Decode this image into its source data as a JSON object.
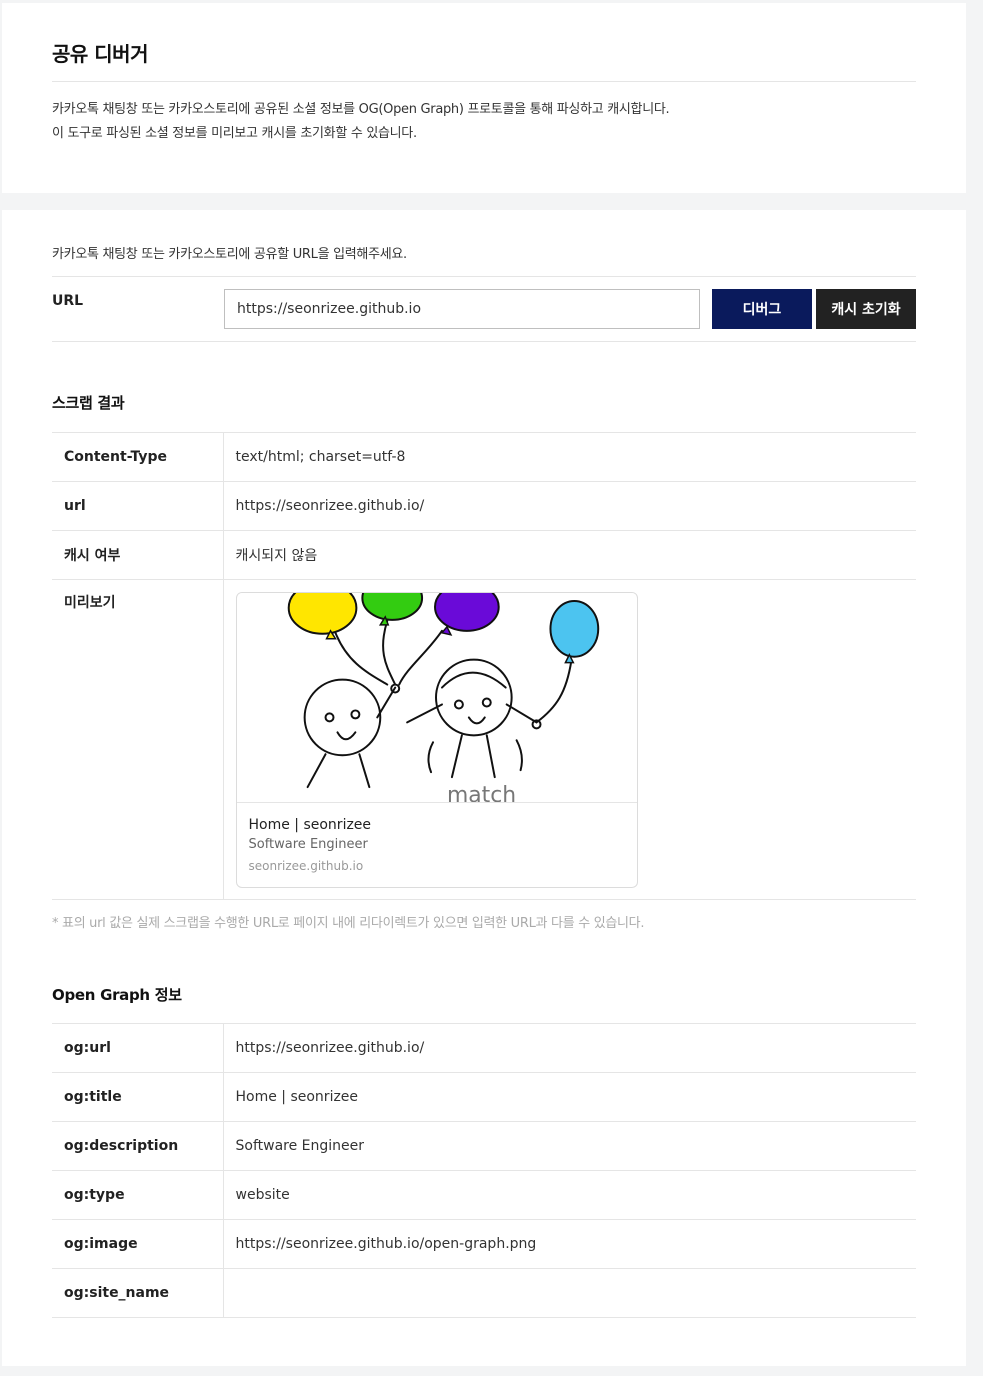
{
  "header": {
    "title": "공유 디버거",
    "description_line1": "카카오톡 채팅창 또는 카카오스토리에 공유된 소셜 정보를 OG(Open Graph) 프로토콜을 통해 파싱하고 캐시합니다.",
    "description_line2": "이 도구로 파싱된 소셜 정보를 미리보고 캐시를 초기화할 수 있습니다."
  },
  "form": {
    "hint": "카카오톡 채팅창 또는 카카오스토리에 공유할 URL을 입력해주세요.",
    "url_label": "URL",
    "url_value": "https://seonrizee.github.io",
    "debug_label": "디버그",
    "reset_label": "캐시 초기화"
  },
  "scrape": {
    "title": "스크랩 결과",
    "rows": [
      {
        "key": "Content-Type",
        "value": "text/html; charset=utf-8"
      },
      {
        "key": "url",
        "value": "https://seonrizee.github.io/"
      },
      {
        "key": "캐시 여부",
        "value": "캐시되지 않음"
      }
    ],
    "preview_key": "미리보기",
    "preview": {
      "title": "Home | seonrizee",
      "description": "Software Engineer",
      "domain": "seonrizee.github.io",
      "image_text": "match"
    },
    "note": "* 표의 url 값은 실제 스크랩을 수행한 URL로 페이지 내에 리다이렉트가 있으면 입력한 URL과 다를 수 있습니다."
  },
  "og": {
    "title": "Open Graph 정보",
    "rows": [
      {
        "key": "og:url",
        "value": "https://seonrizee.github.io/"
      },
      {
        "key": "og:title",
        "value": "Home | seonrizee"
      },
      {
        "key": "og:description",
        "value": "Software Engineer"
      },
      {
        "key": "og:type",
        "value": "website"
      },
      {
        "key": "og:image",
        "value": "https://seonrizee.github.io/open-graph.png"
      },
      {
        "key": "og:site_name",
        "value": ""
      }
    ]
  },
  "colors": {
    "debug_button": "#0a1a5c",
    "reset_button": "#222222",
    "balloon_yellow": "#ffe600",
    "balloon_green": "#33cc11",
    "balloon_purple": "#6a0ad8",
    "balloon_blue": "#4cc4f0"
  }
}
